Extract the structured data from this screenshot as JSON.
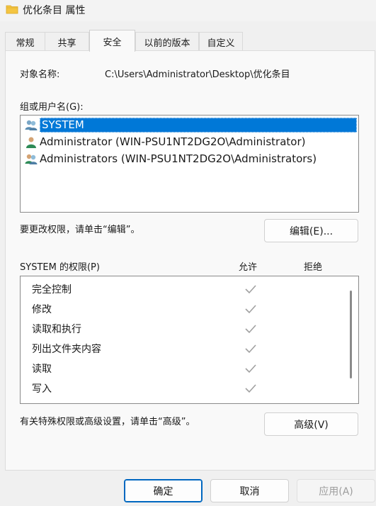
{
  "window": {
    "title": "优化条目 属性"
  },
  "tabs": [
    {
      "label": "常规",
      "active": false
    },
    {
      "label": "共享",
      "active": false
    },
    {
      "label": "安全",
      "active": true
    },
    {
      "label": "以前的版本",
      "active": false
    },
    {
      "label": "自定义",
      "active": false
    }
  ],
  "security": {
    "object_name_label": "对象名称:",
    "object_name_value": "C:\\Users\\Administrator\\Desktop\\优化条目",
    "groups_label": "组或用户名(G):",
    "users": [
      {
        "name": "SYSTEM",
        "selected": true,
        "icon": "user-group-icon"
      },
      {
        "name": "Administrator (WIN-PSU1NT2DG2O\\Administrator)",
        "selected": false,
        "icon": "user-icon"
      },
      {
        "name": "Administrators (WIN-PSU1NT2DG2O\\Administrators)",
        "selected": false,
        "icon": "user-group-icon"
      }
    ],
    "edit_hint": "要更改权限，请单击“编辑”。",
    "edit_button": "编辑(E)...",
    "permissions_label": "SYSTEM 的权限(P)",
    "allow_header": "允许",
    "deny_header": "拒绝",
    "permissions": [
      {
        "name": "完全控制",
        "allow": true,
        "deny": false
      },
      {
        "name": "修改",
        "allow": true,
        "deny": false
      },
      {
        "name": "读取和执行",
        "allow": true,
        "deny": false
      },
      {
        "name": "列出文件夹内容",
        "allow": true,
        "deny": false
      },
      {
        "name": "读取",
        "allow": true,
        "deny": false
      },
      {
        "name": "写入",
        "allow": true,
        "deny": false
      }
    ],
    "advanced_hint": "有关特殊权限或高级设置，请单击“高级”。",
    "advanced_button": "高级(V)"
  },
  "footer": {
    "ok": "确定",
    "cancel": "取消",
    "apply": "应用(A)"
  },
  "colors": {
    "selection": "#0078d7",
    "check": "#a0a0a0",
    "folder": "#f4c542"
  }
}
